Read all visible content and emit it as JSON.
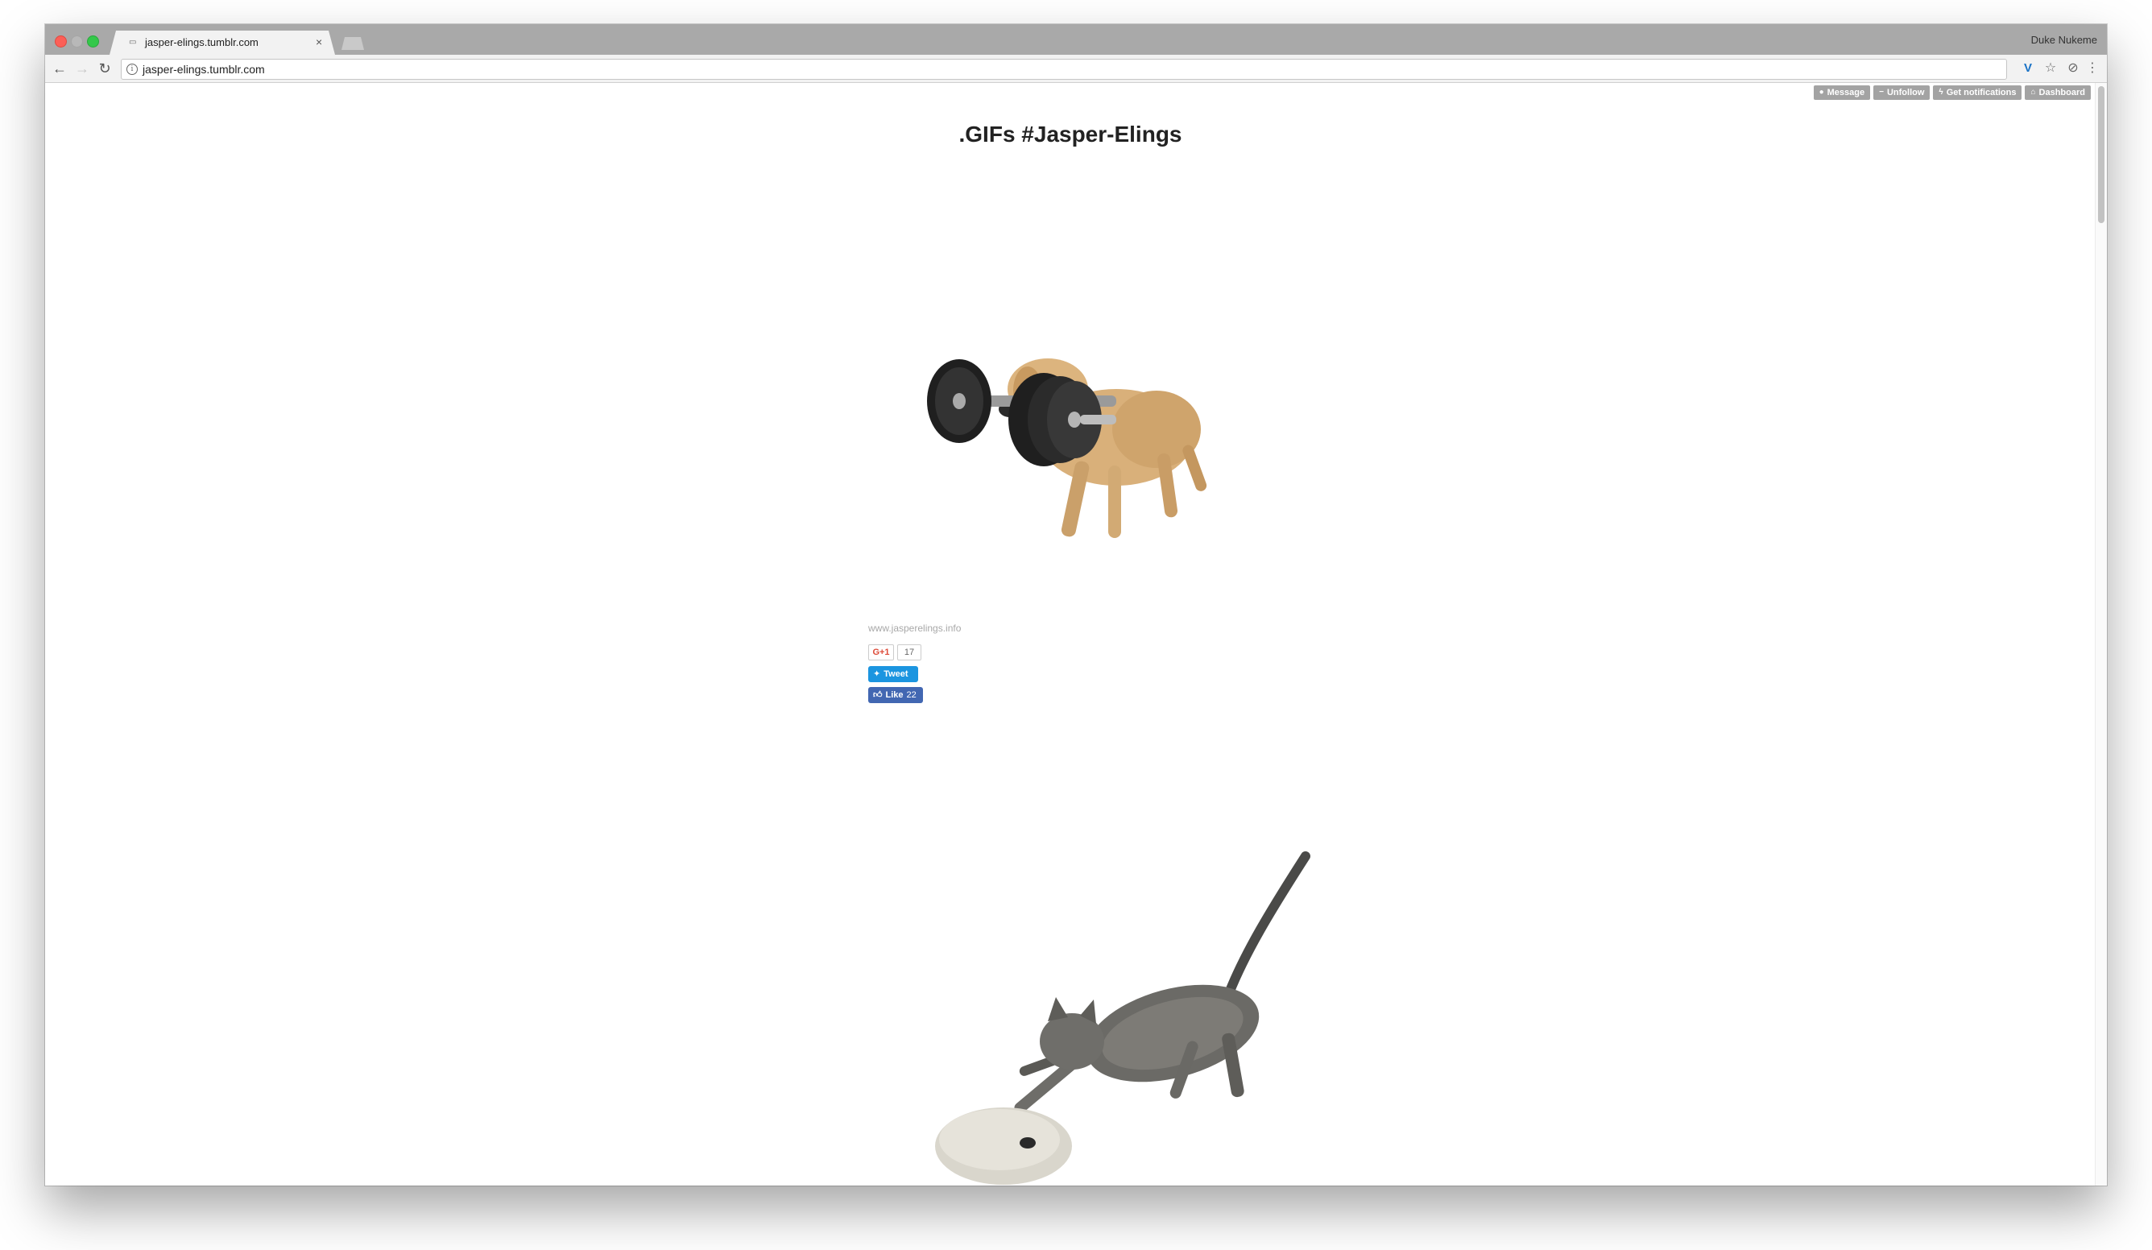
{
  "browser": {
    "tab_title": "jasper-elings.tumblr.com",
    "tab_close": "×",
    "profile_name": "Duke Nukeme",
    "url": "jasper-elings.tumblr.com",
    "icons": {
      "back": "←",
      "forward": "→",
      "reload": "↻",
      "info": "i",
      "extension": "V",
      "star": "☆",
      "shield": "⊘",
      "menu": "⋮"
    }
  },
  "tumblr_controls": {
    "message_label": "Message",
    "unfollow_label": "Unfollow",
    "notifications_label": "Get notifications",
    "dashboard_label": "Dashboard"
  },
  "blog": {
    "title": ".GIFs #Jasper-Elings"
  },
  "post": {
    "source_text": "www.jasperelings.info",
    "gplus_label": "G+1",
    "gplus_count": "17",
    "tweet_label": "Tweet",
    "like_label": "Like",
    "like_count": "22"
  },
  "images": {
    "post1": "dog-lifting-dumbbell",
    "post2": "cat-playing-with-computer-mouse"
  }
}
